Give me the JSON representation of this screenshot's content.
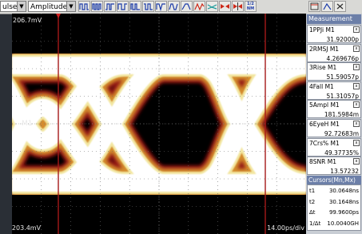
{
  "toolbar": {
    "mode_select": "ulse",
    "type_select": "Amplitude",
    "tool_icons": [
      "pulse-icon-1",
      "pulse-icon-2",
      "pulse-icon-3",
      "pulse-icon-4",
      "pulse-icon-5",
      "pulse-icon-6",
      "pulse-icon-7",
      "pulse-icon-8",
      "ramp-icon",
      "waveform-icon",
      "bowtie-icon-1",
      "bowtie-icon-2",
      "bowtie-icon-3",
      "table-icon"
    ],
    "table_icon_text": "1/2 NM",
    "window_icons": [
      "maximize-icon",
      "split-icon",
      "close-icon"
    ]
  },
  "scope": {
    "top_scale": "206.7mV",
    "bottom_scale": "-203.4mV",
    "time_scale": "14.00ps/div",
    "channel_marker": "M1"
  },
  "measurement": {
    "header": "Measurement",
    "items": [
      {
        "label": "1PPJi",
        "source": "M1",
        "value": "31.92000p"
      },
      {
        "label": "2RMSJ",
        "source": "M1",
        "value": "4.269676p"
      },
      {
        "label": "3Rise",
        "source": "M1",
        "value": "51.59057p"
      },
      {
        "label": "4Fall",
        "source": "M1",
        "value": "51.31057p"
      },
      {
        "label": "5Ampl",
        "source": "M1",
        "value": "181.5984m"
      },
      {
        "label": "6EyeH",
        "source": "M1",
        "value": "92.72683m"
      },
      {
        "label": "7Crs%",
        "source": "M1",
        "value": "49.37735%"
      },
      {
        "label": "8SNR",
        "source": "M1",
        "value": "13.57232"
      }
    ]
  },
  "cursors": {
    "header": "Cursors(Mn,Mx)",
    "rows": [
      {
        "label": "t1",
        "value": "30.0648ns"
      },
      {
        "label": "t2",
        "value": "30.1648ns"
      },
      {
        "label": "Δt",
        "value": "99.9600ps"
      },
      {
        "label": "1/Δt",
        "value": "10.0040GH"
      }
    ]
  },
  "colors": {
    "trace_core": "#ffffff",
    "trace_mid": "#f2e6a0",
    "trace_edge": "#a01818",
    "cursor_line": "#a51a1a",
    "panel_header": "#6c7fa8"
  }
}
